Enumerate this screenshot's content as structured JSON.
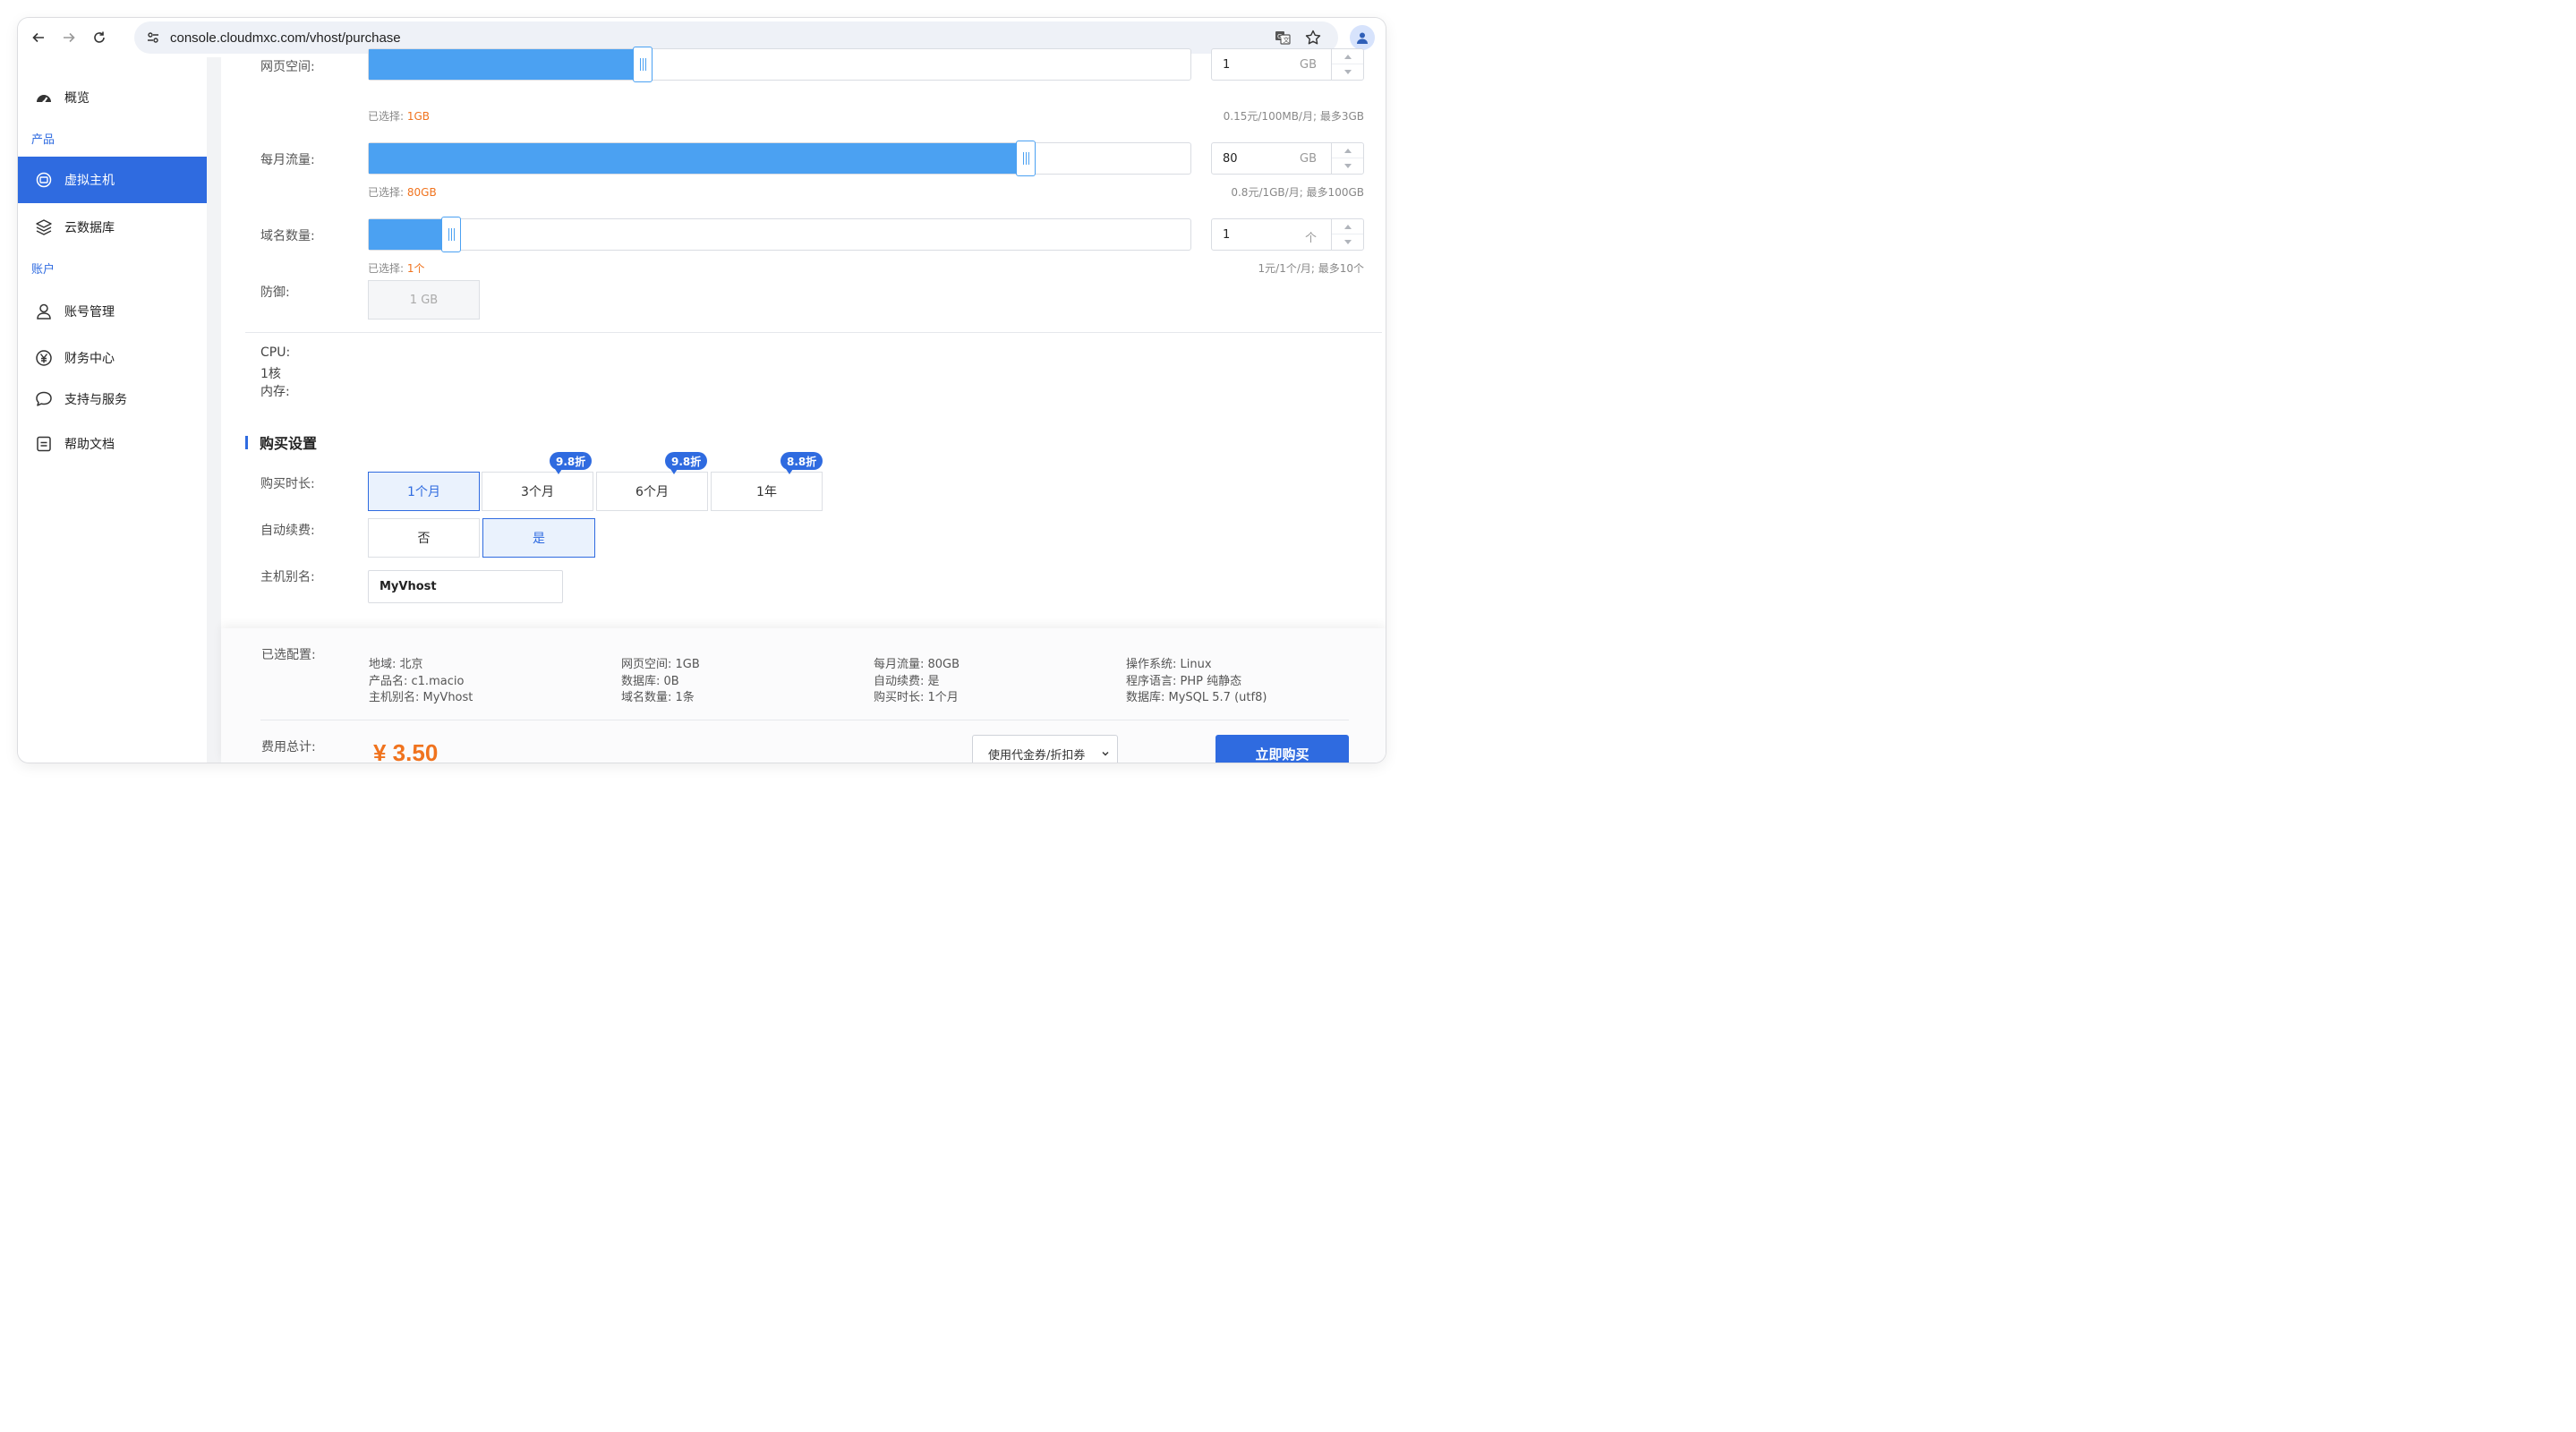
{
  "browser": {
    "url": "console.cloudmxc.com/vhost/purchase"
  },
  "sidebar": {
    "overview": "概览",
    "group_products": "产品",
    "virtual_host": "虚拟主机",
    "cloud_db": "云数据库",
    "group_account": "账户",
    "account_mgmt": "账号管理",
    "finance": "财务中心",
    "support": "支持与服务",
    "help_docs": "帮助文档"
  },
  "config": {
    "web_space": {
      "label": "网页空间:",
      "selected_prefix": "已选择:",
      "selected_value": "1GB",
      "input_value": "1",
      "unit": "GB",
      "hint": "0.15元/100MB/月;  最多3GB",
      "fill_fraction": 0.333
    },
    "traffic": {
      "label": "每月流量:",
      "selected_prefix": "已选择:",
      "selected_value": "80GB",
      "input_value": "80",
      "unit": "GB",
      "hint": "0.8元/1GB/月;  最多100GB",
      "fill_fraction": 0.8
    },
    "domains": {
      "label": "域名数量:",
      "selected_prefix": "已选择:",
      "selected_value": "1个",
      "input_value": "1",
      "unit": "个",
      "hint": "1元/1个/月;  最多10个",
      "fill_fraction": 0.1
    },
    "defense": {
      "label": "防御:",
      "value": "1 GB"
    },
    "cpu_label": "CPU:",
    "cpu_value": "1核",
    "memory_label": "内存:"
  },
  "purchase": {
    "section_title": "购买设置",
    "duration_label": "购买时长:",
    "durations": [
      {
        "label": "1个月",
        "discount": ""
      },
      {
        "label": "3个月",
        "discount": "9.8折"
      },
      {
        "label": "6个月",
        "discount": "9.8折"
      },
      {
        "label": "1年",
        "discount": "8.8折"
      }
    ],
    "auto_renew_label": "自动续费:",
    "auto_renew_options": [
      "否",
      "是"
    ],
    "alias_label": "主机别名:",
    "alias_value": "MyVhost"
  },
  "summary": {
    "label": "已选配置:",
    "col1": [
      "地域: 北京",
      "产品名: c1.macio",
      "主机别名: MyVhost"
    ],
    "col2": [
      "网页空间: 1GB",
      "数据库: 0B",
      "域名数量: 1条"
    ],
    "col3": [
      "每月流量: 80GB",
      "自动续费: 是",
      "购买时长: 1个月"
    ],
    "col4": [
      "操作系统: Linux",
      "程序语言: PHP 纯静态",
      "数据库: MySQL 5.7 (utf8)"
    ],
    "total_label": "费用总计:",
    "price": "¥ 3.50",
    "coupon_label": "使用代金券/折扣券",
    "buy_label": "立即购买"
  },
  "colors": {
    "accent": "#2f6be0",
    "slider_fill": "#4ba1f2",
    "price": "#f0731e"
  }
}
